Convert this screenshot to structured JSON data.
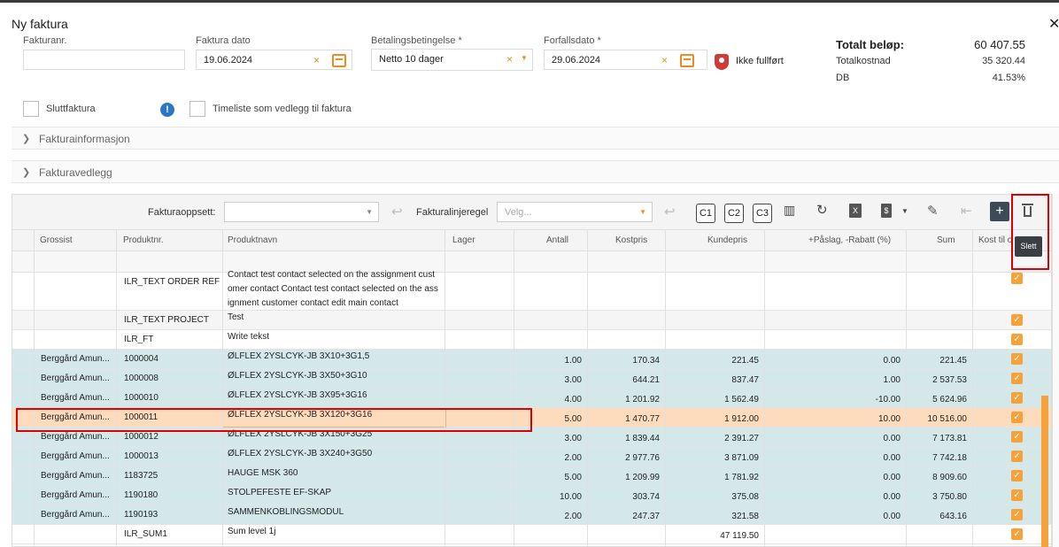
{
  "title": "Ny faktura",
  "form": {
    "invoice_no_label": "Fakturanr.",
    "invoice_no_value": "",
    "invoice_date_label": "Faktura dato",
    "invoice_date_value": "19.06.2024",
    "payment_terms_label": "Betalingsbetingelse *",
    "payment_terms_value": "Netto 10 dager",
    "due_date_label": "Forfallsdato *",
    "due_date_value": "29.06.2024",
    "status_text": "Ikke fullført"
  },
  "totals": {
    "total_label": "Totalt beløp:",
    "total_value": "60 407.55",
    "cost_label": "Totalkostnad",
    "cost_value": "35 320.44",
    "db_label": "DB",
    "db_value": "41.53%"
  },
  "checkboxes": {
    "final_invoice": "Sluttfaktura",
    "timesheet": "Timeliste som vedlegg til faktura"
  },
  "sections": {
    "info": "Fakturainformasjon",
    "attachments": "Fakturavedlegg"
  },
  "toolbar": {
    "setup_label": "Fakturaoppsett:",
    "line_rule_label": "Fakturalinjeregel",
    "line_rule_placeholder": "Velg...",
    "c1": "C1",
    "c2": "C2",
    "c3": "C3",
    "tooltip": "Slett"
  },
  "columns": [
    "Grossist",
    "Produktnr.",
    "Produktnavn",
    "Lager",
    "Antall",
    "Kostpris",
    "Kundepris",
    "+Påslag, -Rabatt (%)",
    "Sum",
    "Kost til o"
  ],
  "rows": [
    {
      "grossist": "",
      "prodnr": "ILR_TEXT ORDER REF",
      "navn1": "Contact test contact selected on the assignment cust",
      "navn2": "omer contact Contact test contact selected on the ass",
      "navn3": "ignment customer contact edit main contact",
      "antall": "",
      "kost": "",
      "kunde": "",
      "pct": "",
      "sum": "",
      "style": "white"
    },
    {
      "grossist": "",
      "prodnr": "ILR_TEXT PROJECT",
      "navn1": "Test",
      "antall": "",
      "kost": "",
      "kunde": "",
      "pct": "",
      "sum": "",
      "style": "grey"
    },
    {
      "grossist": "",
      "prodnr": "ILR_FT",
      "navn1": "Write tekst",
      "antall": "",
      "kost": "",
      "kunde": "",
      "pct": "",
      "sum": "",
      "style": "white"
    },
    {
      "grossist": "Berggård Amun...",
      "prodnr": "1000004",
      "navn1": "ØLFLEX 2YSLCYK-JB 3X10+3G1,5",
      "antall": "1.00",
      "kost": "170.34",
      "kunde": "221.45",
      "pct": "0.00",
      "sum": "221.45",
      "style": "teal"
    },
    {
      "grossist": "Berggård Amun...",
      "prodnr": "1000008",
      "navn1": "ØLFLEX 2YSLCYK-JB 3X50+3G10",
      "antall": "3.00",
      "kost": "644.21",
      "kunde": "837.47",
      "pct": "1.00",
      "sum": "2 537.53",
      "style": "teal"
    },
    {
      "grossist": "Berggård Amun...",
      "prodnr": "1000010",
      "navn1": "ØLFLEX 2YSLCYK-JB 3X95+3G16",
      "antall": "4.00",
      "kost": "1 201.92",
      "kunde": "1 562.49",
      "pct": "-10.00",
      "sum": "5 624.96",
      "style": "teal"
    },
    {
      "grossist": "Berggård Amun...",
      "prodnr": "1000011",
      "navn1": "ØLFLEX 2YSLCYK-JB 3X120+3G16",
      "antall": "5.00",
      "kost": "1 470.77",
      "kunde": "1 912.00",
      "pct": "10.00",
      "sum": "10 516.00",
      "style": "selected"
    },
    {
      "grossist": "Berggård Amun...",
      "prodnr": "1000012",
      "navn1": "ØLFLEX 2YSLCYK-JB 3X150+3G25",
      "antall": "3.00",
      "kost": "1 839.44",
      "kunde": "2 391.27",
      "pct": "0.00",
      "sum": "7 173.81",
      "style": "teal"
    },
    {
      "grossist": "Berggård Amun...",
      "prodnr": "1000013",
      "navn1": "ØLFLEX 2YSLCYK-JB 3X240+3G50",
      "antall": "2.00",
      "kost": "2 977.76",
      "kunde": "3 871.09",
      "pct": "0.00",
      "sum": "7 742.18",
      "style": "teal"
    },
    {
      "grossist": "Berggård Amun...",
      "prodnr": "1183725",
      "navn1": "HAUGE MSK 360",
      "antall": "5.00",
      "kost": "1 209.99",
      "kunde": "1 781.92",
      "pct": "0.00",
      "sum": "8 909.60",
      "style": "teal"
    },
    {
      "grossist": "Berggård Amun...",
      "prodnr": "1190180",
      "navn1": "STOLPEFESTE EF-SKAP",
      "antall": "10.00",
      "kost": "303.74",
      "kunde": "375.08",
      "pct": "0.00",
      "sum": "3 750.80",
      "style": "teal"
    },
    {
      "grossist": "Berggård Amun...",
      "prodnr": "1190193",
      "navn1": "SAMMENKOBLINGSMODUL",
      "antall": "2.00",
      "kost": "247.37",
      "kunde": "321.58",
      "pct": "0.00",
      "sum": "643.16",
      "style": "teal"
    },
    {
      "grossist": "",
      "prodnr": "ILR_SUM1",
      "navn1": "Sum level 1j",
      "antall": "",
      "kost": "",
      "kunde": "47 119.50",
      "pct": "",
      "sum": "",
      "style": "white"
    }
  ],
  "colors": {
    "accent": "#f6a13a",
    "teal": "#d4e8ea",
    "selected": "#fcdcbc",
    "highlight_border": "#e00000"
  }
}
